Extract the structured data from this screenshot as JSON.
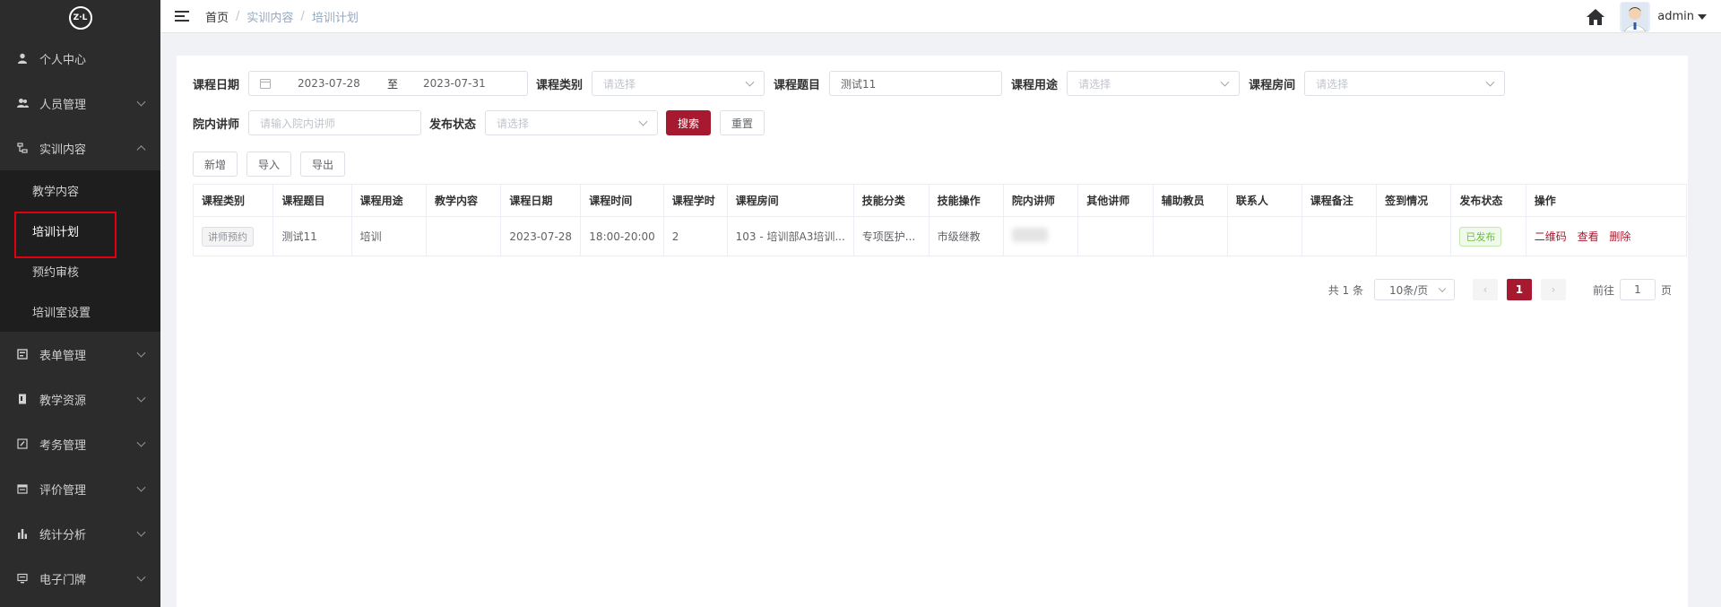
{
  "logo": {
    "text": "Z·L"
  },
  "sidebar": {
    "items": [
      {
        "label": "个人中心",
        "icon": "user-icon"
      },
      {
        "label": "人员管理",
        "icon": "users-icon"
      },
      {
        "label": "实训内容",
        "icon": "tree-icon",
        "expanded": true,
        "children": [
          {
            "label": "教学内容"
          },
          {
            "label": "培训计划",
            "active": true
          },
          {
            "label": "预约审核"
          },
          {
            "label": "培训室设置"
          }
        ]
      },
      {
        "label": "表单管理",
        "icon": "form-icon"
      },
      {
        "label": "教学资源",
        "icon": "book-icon"
      },
      {
        "label": "考务管理",
        "icon": "edit-icon"
      },
      {
        "label": "评价管理",
        "icon": "calendar-icon"
      },
      {
        "label": "统计分析",
        "icon": "bar-chart-icon"
      },
      {
        "label": "电子门牌",
        "icon": "monitor-icon"
      }
    ]
  },
  "header": {
    "breadcrumb": [
      "首页",
      "实训内容",
      "培训计划"
    ],
    "user": "admin"
  },
  "filters": {
    "course_date_label": "课程日期",
    "date_start": "2023-07-28",
    "date_sep": "至",
    "date_end": "2023-07-31",
    "course_category_label": "课程类别",
    "course_category_placeholder": "请选择",
    "course_title_label": "课程题目",
    "course_title_value": "测试11",
    "course_usage_label": "课程用途",
    "course_usage_placeholder": "请选择",
    "course_room_label": "课程房间",
    "course_room_placeholder": "请选择",
    "lecturer_label": "院内讲师",
    "lecturer_placeholder": "请输入院内讲师",
    "publish_status_label": "发布状态",
    "publish_status_placeholder": "请选择",
    "search_button": "搜索",
    "reset_button": "重置"
  },
  "actions": {
    "add": "新增",
    "import": "导入",
    "export": "导出"
  },
  "table": {
    "headers": [
      "课程类别",
      "课程题目",
      "课程用途",
      "教学内容",
      "课程日期",
      "课程时间",
      "课程学时",
      "课程房间",
      "技能分类",
      "技能操作",
      "院内讲师",
      "其他讲师",
      "辅助教员",
      "联系人",
      "课程备注",
      "签到情况",
      "发布状态",
      "操作"
    ],
    "rows": [
      {
        "category": "讲师预约",
        "title": "测试11",
        "usage": "培训",
        "content": "",
        "date": "2023-07-28",
        "time": "18:00-20:00",
        "hours": "2",
        "room": "103 - 培训部A3培训...",
        "skill_class": "专项医护...",
        "skill_op": "市级继教",
        "lecturer": "",
        "other_lecturer": "",
        "assistant": "",
        "contact": "",
        "remark": "",
        "signin": "",
        "status": "已发布",
        "ops": [
          "二维码",
          "查看",
          "删除"
        ]
      }
    ]
  },
  "pagination": {
    "total": "共 1 条",
    "page_size": "10条/页",
    "current_page": "1",
    "goto_label": "前往",
    "goto_value": "1",
    "page_unit": "页"
  }
}
